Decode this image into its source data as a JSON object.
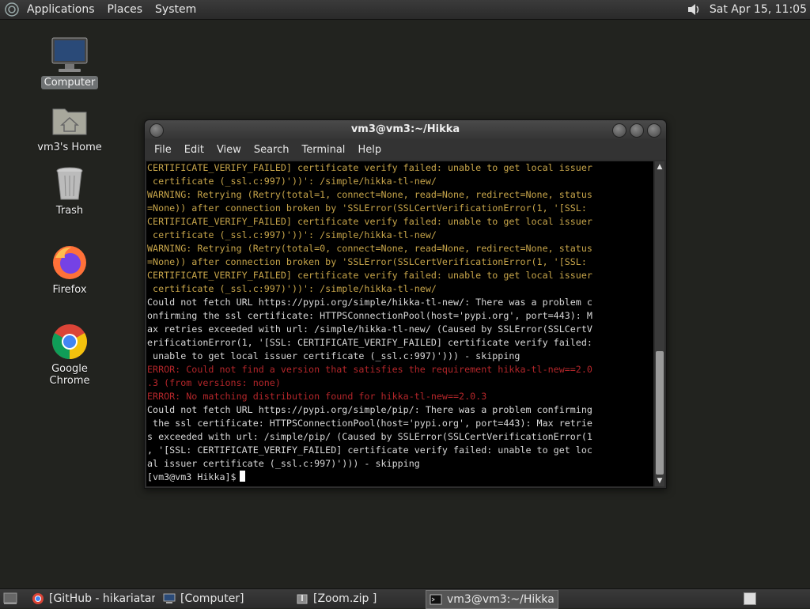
{
  "top_panel": {
    "menus": [
      "Applications",
      "Places",
      "System"
    ],
    "clock": "Sat Apr 15, 11:05"
  },
  "desktop": {
    "icons": [
      {
        "label": "Computer"
      },
      {
        "label": "vm3's Home"
      },
      {
        "label": "Trash"
      },
      {
        "label": "Firefox"
      },
      {
        "label": "Google Chrome"
      }
    ]
  },
  "terminal": {
    "title": "vm3@vm3:~/Hikka",
    "menu": [
      "File",
      "Edit",
      "View",
      "Search",
      "Terminal",
      "Help"
    ],
    "lines": [
      {
        "kind": "warn",
        "text": "CERTIFICATE_VERIFY_FAILED] certificate verify failed: unable to get local issuer"
      },
      {
        "kind": "warn",
        "text": " certificate (_ssl.c:997)'))': /simple/hikka-tl-new/"
      },
      {
        "kind": "warn",
        "text": "WARNING: Retrying (Retry(total=1, connect=None, read=None, redirect=None, status"
      },
      {
        "kind": "warn",
        "text": "=None)) after connection broken by 'SSLError(SSLCertVerificationError(1, '[SSL:"
      },
      {
        "kind": "warn",
        "text": "CERTIFICATE_VERIFY_FAILED] certificate verify failed: unable to get local issuer"
      },
      {
        "kind": "warn",
        "text": " certificate (_ssl.c:997)'))': /simple/hikka-tl-new/"
      },
      {
        "kind": "warn",
        "text": "WARNING: Retrying (Retry(total=0, connect=None, read=None, redirect=None, status"
      },
      {
        "kind": "warn",
        "text": "=None)) after connection broken by 'SSLError(SSLCertVerificationError(1, '[SSL:"
      },
      {
        "kind": "warn",
        "text": "CERTIFICATE_VERIFY_FAILED] certificate verify failed: unable to get local issuer"
      },
      {
        "kind": "warn",
        "text": " certificate (_ssl.c:997)'))': /simple/hikka-tl-new/"
      },
      {
        "kind": "norm",
        "text": "Could not fetch URL https://pypi.org/simple/hikka-tl-new/: There was a problem c"
      },
      {
        "kind": "norm",
        "text": "onfirming the ssl certificate: HTTPSConnectionPool(host='pypi.org', port=443): M"
      },
      {
        "kind": "norm",
        "text": "ax retries exceeded with url: /simple/hikka-tl-new/ (Caused by SSLError(SSLCertV"
      },
      {
        "kind": "norm",
        "text": "erificationError(1, '[SSL: CERTIFICATE_VERIFY_FAILED] certificate verify failed:"
      },
      {
        "kind": "norm",
        "text": " unable to get local issuer certificate (_ssl.c:997)'))) - skipping"
      },
      {
        "kind": "err",
        "text": "ERROR: Could not find a version that satisfies the requirement hikka-tl-new==2.0"
      },
      {
        "kind": "err",
        "text": ".3 (from versions: none)"
      },
      {
        "kind": "err",
        "text": "ERROR: No matching distribution found for hikka-tl-new==2.0.3"
      },
      {
        "kind": "norm",
        "text": "Could not fetch URL https://pypi.org/simple/pip/: There was a problem confirming"
      },
      {
        "kind": "norm",
        "text": " the ssl certificate: HTTPSConnectionPool(host='pypi.org', port=443): Max retrie"
      },
      {
        "kind": "norm",
        "text": "s exceeded with url: /simple/pip/ (Caused by SSLError(SSLCertVerificationError(1"
      },
      {
        "kind": "norm",
        "text": ", '[SSL: CERTIFICATE_VERIFY_FAILED] certificate verify failed: unable to get loc"
      },
      {
        "kind": "norm",
        "text": "al issuer certificate (_ssl.c:997)'))) - skipping"
      }
    ],
    "prompt": "[vm3@vm3 Hikka]$"
  },
  "taskbar": {
    "tasks": [
      {
        "label": "[GitHub - hikariatam…",
        "icon": "chrome-icon",
        "active": false
      },
      {
        "label": "[Computer]",
        "icon": "computer-icon",
        "active": false
      },
      {
        "label": "[Zoom.zip ]",
        "icon": "archive-icon",
        "active": false
      },
      {
        "label": "vm3@vm3:~/Hikka",
        "icon": "terminal-icon",
        "active": true
      }
    ]
  },
  "colors": {
    "desktop_bg": "#22231f",
    "warning_text": "#c7a54a",
    "error_text": "#b4262a",
    "terminal_bg": "#000000"
  }
}
